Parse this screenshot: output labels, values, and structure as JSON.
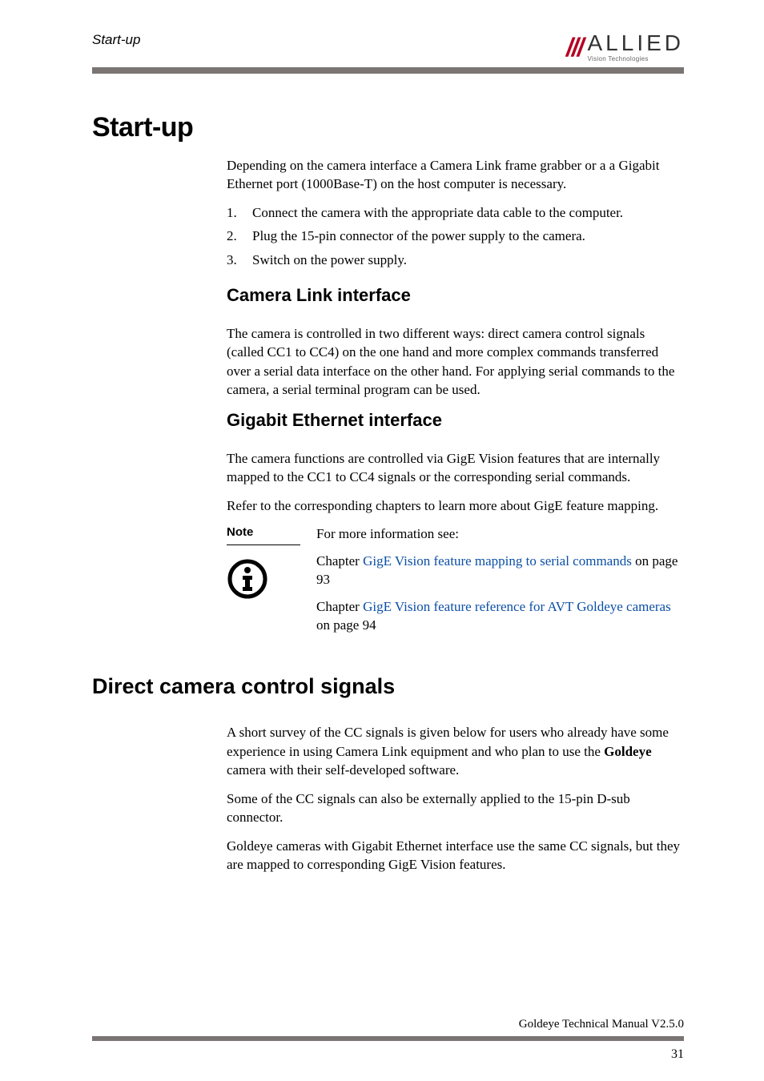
{
  "header": {
    "running": "Start-up",
    "logo_main": "ALLIED",
    "logo_sub": "Vision Technologies"
  },
  "title": "Start-up",
  "intro": "Depending on the camera interface a Camera Link frame grabber or a a Gigabit Ethernet port (1000Base-T) on the host computer is necessary.",
  "steps": [
    "Connect the camera with the appropriate data cable to the computer.",
    "Plug the 15-pin connector of the power supply to the camera.",
    "Switch on the power supply."
  ],
  "cl": {
    "heading": "Camera Link interface",
    "para": "The camera is controlled in two different ways: direct camera control signals (called CC1 to CC4) on the one hand and more complex commands transferred over a serial data interface on the other hand. For applying serial commands to the camera, a serial terminal program can be used."
  },
  "ge": {
    "heading": "Gigabit Ethernet interface",
    "p1": "The camera functions are controlled via GigE Vision features that are internally mapped to the CC1 to CC4 signals or the corresponding serial commands.",
    "p2": "Refer to the corresponding chapters to learn more about GigE feature mapping."
  },
  "note": {
    "label": "Note",
    "lead": "For more information see:",
    "c1_pre": "Chapter ",
    "c1_link": "GigE Vision feature mapping to serial commands",
    "c1_post": " on page 93",
    "c2_pre": "Chapter ",
    "c2_link": "GigE Vision feature reference for AVT Goldeye cameras",
    "c2_post": " on page 94"
  },
  "dcc": {
    "heading": "Direct camera control signals",
    "p1a": "A short survey of the CC signals is given below for users who already have some experience in using Camera Link equipment and who plan to use the ",
    "p1b": "Goldeye",
    "p1c": " camera with their self-developed software.",
    "p2": "Some of the CC signals can also be externally applied to the 15-pin D-sub connector.",
    "p3": "Goldeye cameras with Gigabit Ethernet interface use the same CC signals, but they are mapped to corresponding GigE Vision features."
  },
  "footer": {
    "text": "Goldeye Technical Manual V2.5.0",
    "page": "31"
  }
}
